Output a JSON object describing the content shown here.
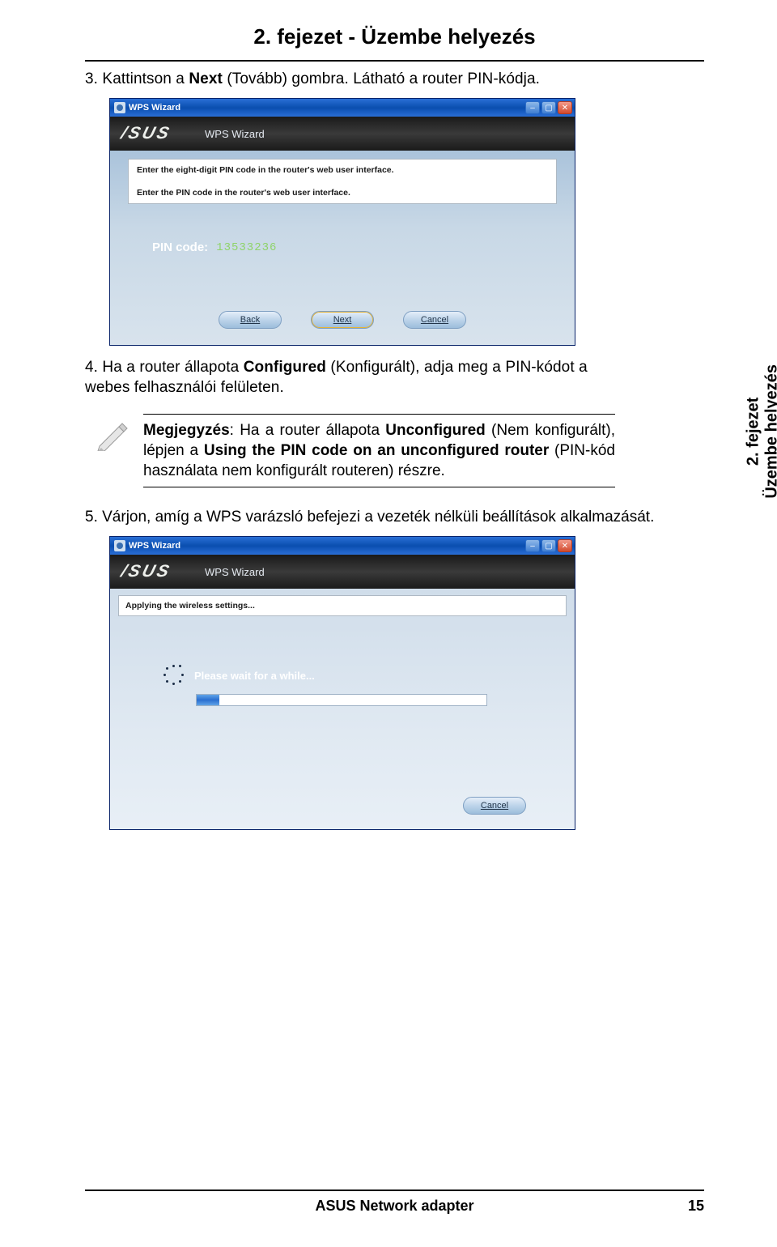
{
  "chapter_title": "2. fejezet - Üzembe helyezés",
  "side_tab": {
    "line1": "2. fejezet",
    "line2": "Üzembe helyezés"
  },
  "step3": {
    "prefix": "3. Kattintson a ",
    "bold": "Next",
    "suffix": " (Tovább) gombra. Látható a router PIN-kódja."
  },
  "step4": {
    "prefix": "4. Ha a router állapota ",
    "bold": "Configured",
    "suffix": " (Konfigurált), adja meg a PIN-kódot a webes felhasználói felületen."
  },
  "step5": {
    "text": "5. Várjon, amíg a WPS varázsló befejezi a vezeték nélküli beállítások alkalmazását."
  },
  "note": {
    "label": "Megjegyzés",
    "seg1": ": Ha a router állapota ",
    "bold1": "Unconfigured",
    "seg2": " (Nem konfigurált), lépjen a ",
    "bold2": "Using the PIN code on an unconfigured router",
    "seg3": " (PIN-kód használata nem konfigurált routeren) részre."
  },
  "window1": {
    "title": "WPS Wizard",
    "brand_title": "WPS Wizard",
    "panel_line1": "Enter the eight-digit PIN code in the router's web user interface.",
    "panel_line2": "Enter the PIN code in the router's web user interface.",
    "pin_label": "PIN code:",
    "pin_value": "13533236",
    "btn_back": "Back",
    "btn_next": "Next",
    "btn_cancel": "Cancel"
  },
  "window2": {
    "title": "WPS Wizard",
    "brand_title": "WPS Wizard",
    "applying": "Applying the wireless settings...",
    "wait_text": "Please wait for a while...",
    "btn_cancel": "Cancel"
  },
  "footer": {
    "center": "ASUS Network adapter",
    "page": "15"
  }
}
